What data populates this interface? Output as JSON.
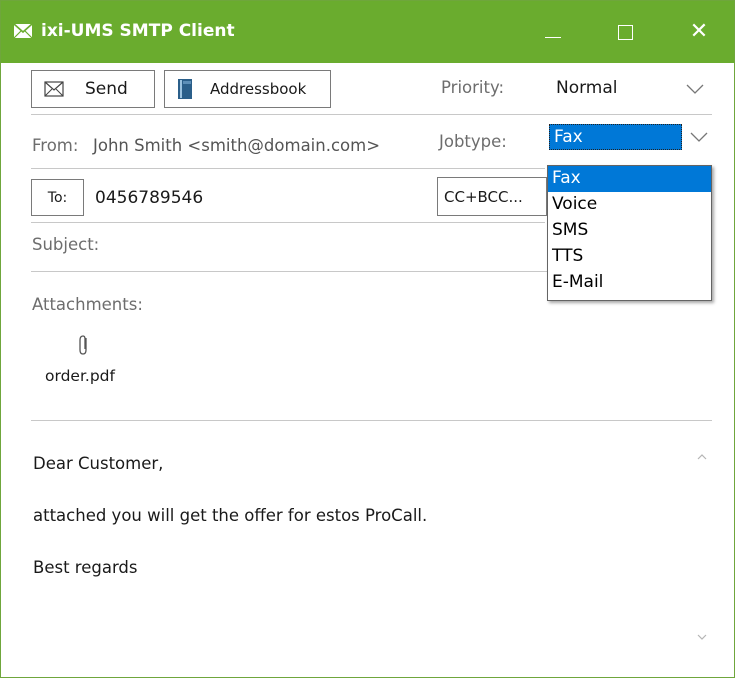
{
  "window": {
    "title": "ixi-UMS SMTP Client",
    "accent_color": "#6aac2e",
    "title_icon": "mail-icon",
    "controls": {
      "minimize": "minimize-icon",
      "maximize": "maximize-icon",
      "close": "✕"
    }
  },
  "toolbar": {
    "send_label": "Send",
    "send_icon": "envelope-icon",
    "addressbook_label": "Addressbook",
    "addressbook_icon": "book-icon"
  },
  "priority": {
    "label": "Priority:",
    "value": "Normal"
  },
  "from": {
    "label": "From:",
    "value": "John Smith <smith@domain.com>"
  },
  "jobtype": {
    "label": "Jobtype:",
    "value": "Fax",
    "options": [
      "Fax",
      "Voice",
      "SMS",
      "TTS",
      "E-Mail"
    ],
    "selected_color": "#0078d7"
  },
  "to": {
    "button_label": "To:",
    "value": "0456789546"
  },
  "cc": {
    "button_label": "CC+BCC..."
  },
  "subject": {
    "label": "Subject:",
    "value": ""
  },
  "attachments": {
    "label": "Attachments:",
    "items": [
      {
        "name": "order.pdf",
        "icon": "paperclip-icon"
      }
    ]
  },
  "message": {
    "lines": [
      "Dear Customer,",
      "attached you will get the offer for estos ProCall.",
      "Best regards"
    ]
  }
}
